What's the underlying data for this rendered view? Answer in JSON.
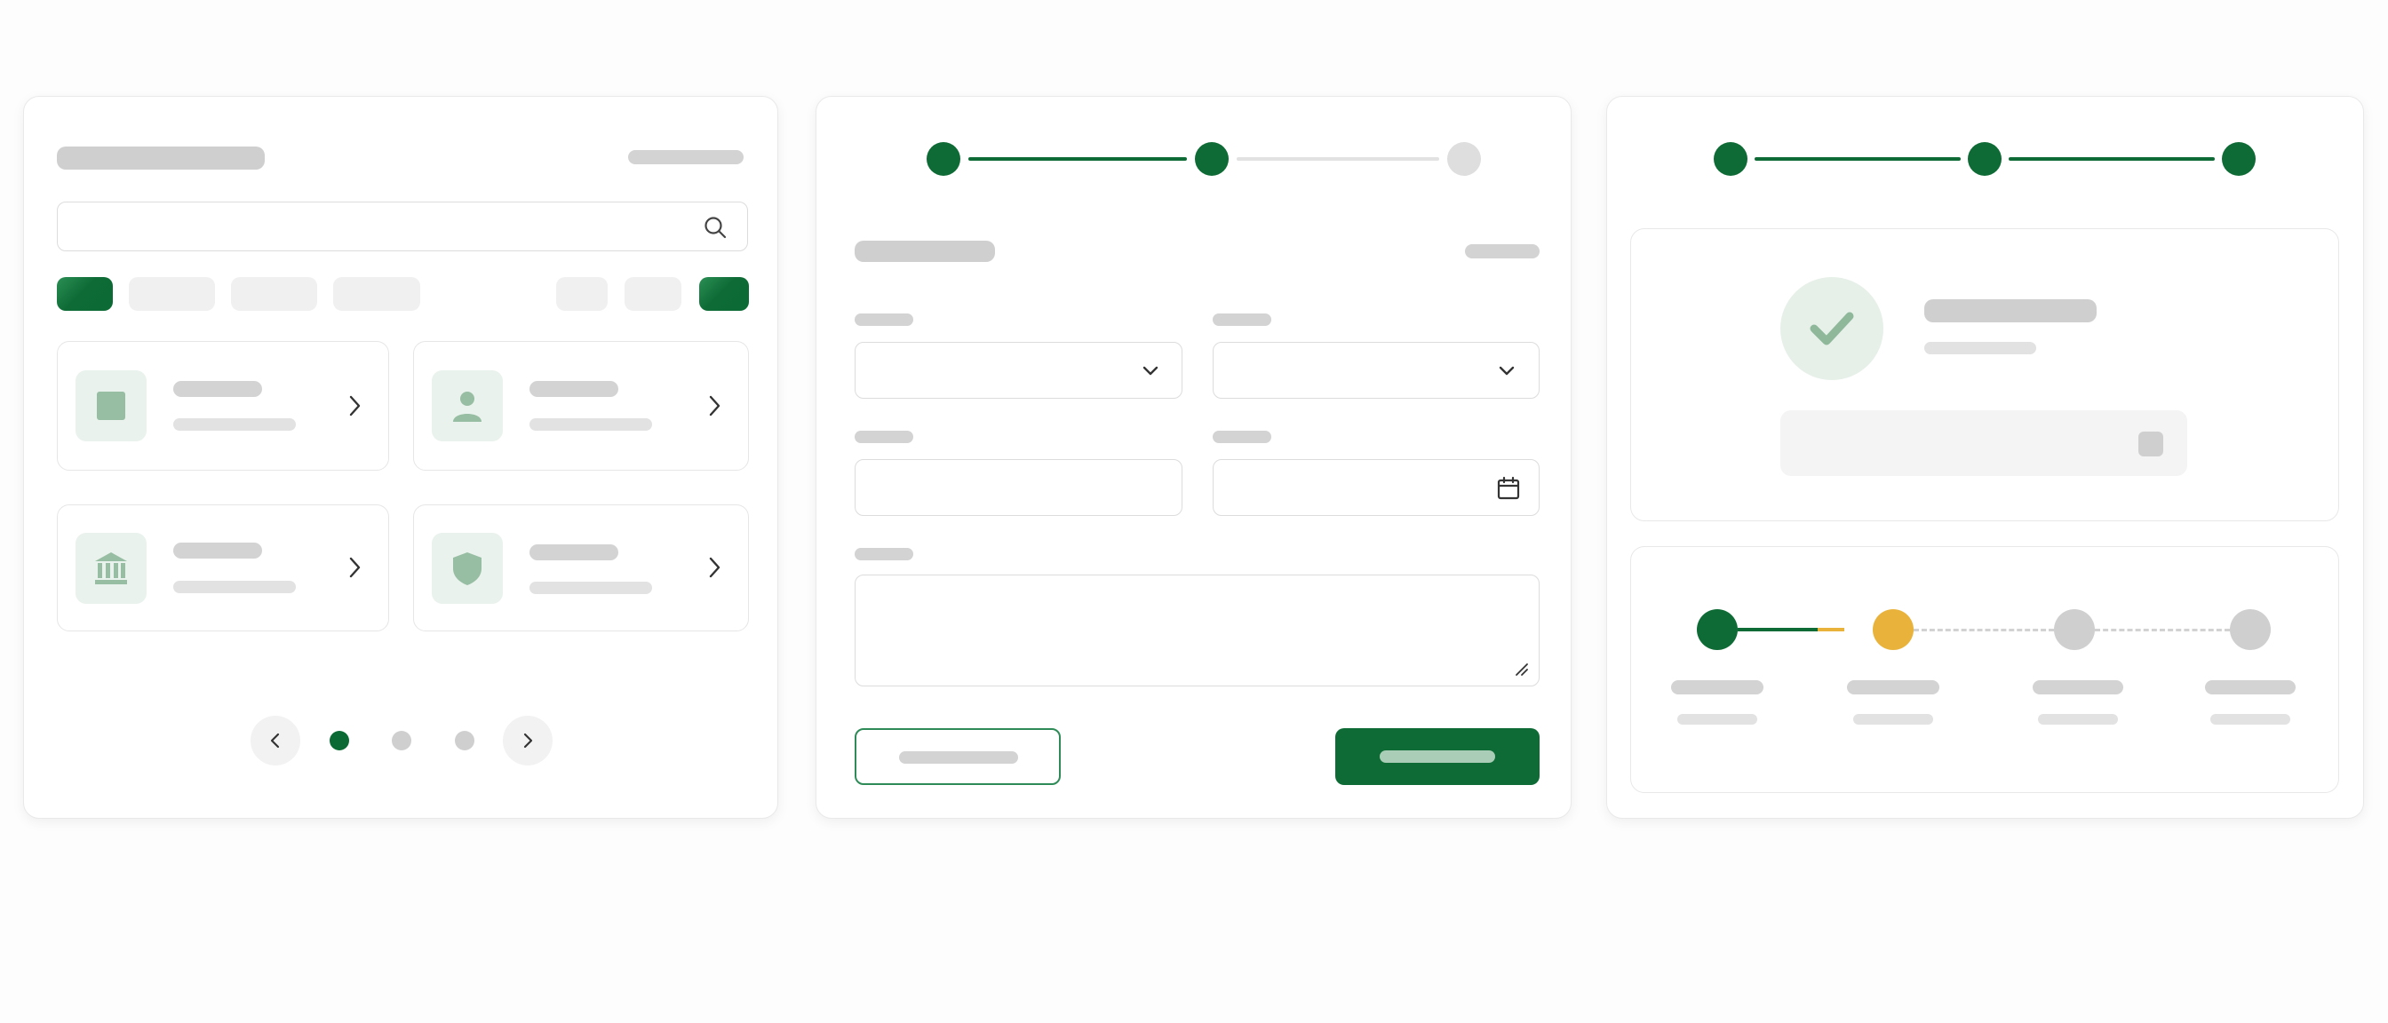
{
  "colors": {
    "brand_green": "#0e6b35",
    "accent_yellow": "#e9b23b",
    "placeholder_grey": "#cfcfcf"
  },
  "browse_panel": {
    "search": {
      "placeholder": "",
      "icon": "search-icon"
    },
    "filter_chips": [
      {
        "label": "",
        "selected": true
      },
      {
        "label": "",
        "selected": false
      },
      {
        "label": "",
        "selected": false
      },
      {
        "label": "",
        "selected": false
      }
    ],
    "action_chips": [
      {
        "label": ""
      },
      {
        "label": ""
      },
      {
        "label": "",
        "primary": true
      }
    ],
    "cards": [
      {
        "icon": "square-icon",
        "title": "",
        "subtitle": ""
      },
      {
        "icon": "user-icon",
        "title": "",
        "subtitle": ""
      },
      {
        "icon": "bank-icon",
        "title": "",
        "subtitle": ""
      },
      {
        "icon": "shield-icon",
        "title": "",
        "subtitle": ""
      }
    ],
    "pagination": {
      "pages": 3,
      "current": 1
    }
  },
  "form_panel": {
    "stepper": {
      "steps": 3,
      "completed": 2
    },
    "title": "",
    "meta": "",
    "fields": [
      {
        "label": "",
        "type": "select",
        "value": "",
        "icon": "chevron-down-icon"
      },
      {
        "label": "",
        "type": "select",
        "value": "",
        "icon": "chevron-down-icon"
      },
      {
        "label": "",
        "type": "text",
        "value": ""
      },
      {
        "label": "",
        "type": "date",
        "value": "",
        "icon": "calendar-icon"
      },
      {
        "label": "",
        "type": "textarea",
        "value": "",
        "icon": "resize-handle-icon"
      }
    ],
    "secondary_button": "",
    "primary_button": ""
  },
  "confirmation_panel": {
    "stepper": {
      "steps": 3,
      "completed": 3
    },
    "summary": {
      "icon": "check-icon",
      "title": "",
      "subtitle": "",
      "status_icon": "square-icon"
    },
    "timeline": {
      "steps": [
        {
          "label": "",
          "sublabel": "",
          "state": "done"
        },
        {
          "label": "",
          "sublabel": "",
          "state": "current"
        },
        {
          "label": "",
          "sublabel": "",
          "state": "pending"
        },
        {
          "label": "",
          "sublabel": "",
          "state": "pending"
        }
      ]
    }
  }
}
